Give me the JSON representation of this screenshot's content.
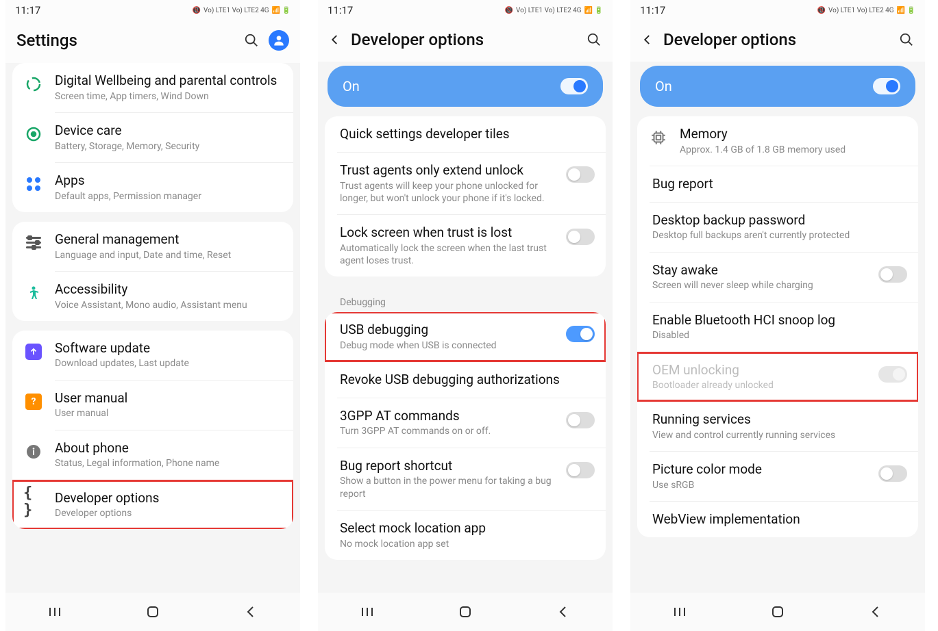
{
  "statusbar_time": "11:17",
  "statusbar_signal": "Vo) LTE1 Vo) LTE2 4G",
  "screen1": {
    "title": "Settings",
    "items": [
      {
        "title": "Digital Wellbeing and parental controls",
        "sub": "Screen time, App timers, Wind Down"
      },
      {
        "title": "Device care",
        "sub": "Battery, Storage, Memory, Security"
      },
      {
        "title": "Apps",
        "sub": "Default apps, Permission manager"
      },
      {
        "title": "General management",
        "sub": "Language and input, Date and time, Reset"
      },
      {
        "title": "Accessibility",
        "sub": "Voice Assistant, Mono audio, Assistant menu"
      },
      {
        "title": "Software update",
        "sub": "Download updates, Last update"
      },
      {
        "title": "User manual",
        "sub": "User manual"
      },
      {
        "title": "About phone",
        "sub": "Status, Legal information, Phone name"
      },
      {
        "title": "Developer options",
        "sub": "Developer options"
      }
    ]
  },
  "screen2": {
    "title": "Developer options",
    "pill": "On",
    "section0": [
      {
        "title": "Quick settings developer tiles"
      },
      {
        "title": "Trust agents only extend unlock",
        "sub": "Trust agents will keep your phone unlocked for longer, but won't unlock your phone if it's locked.",
        "toggle": "off"
      },
      {
        "title": "Lock screen when trust is lost",
        "sub": "Automatically lock the screen when the last trust agent loses trust.",
        "toggle": "off"
      }
    ],
    "section_label": "Debugging",
    "section1": [
      {
        "title": "USB debugging",
        "sub": "Debug mode when USB is connected",
        "toggle": "on"
      },
      {
        "title": "Revoke USB debugging authorizations"
      },
      {
        "title": "3GPP AT commands",
        "sub": "Turn 3GPP AT commands on or off.",
        "toggle": "off"
      },
      {
        "title": "Bug report shortcut",
        "sub": "Show a button in the power menu for taking a bug report",
        "toggle": "off"
      },
      {
        "title": "Select mock location app",
        "sub": "No mock location app set"
      }
    ]
  },
  "screen3": {
    "title": "Developer options",
    "pill": "On",
    "items": [
      {
        "title": "Memory",
        "sub": "Approx. 1.4 GB of 1.8 GB memory used"
      },
      {
        "title": "Bug report"
      },
      {
        "title": "Desktop backup password",
        "sub": "Desktop full backups aren't currently protected"
      },
      {
        "title": "Stay awake",
        "sub": "Screen will never sleep while charging",
        "toggle": "off"
      },
      {
        "title": "Enable Bluetooth HCI snoop log",
        "sub": "Disabled"
      },
      {
        "title": "OEM unlocking",
        "sub": "Bootloader already unlocked",
        "toggle": "disabled"
      },
      {
        "title": "Running services",
        "sub": "View and control currently running services"
      },
      {
        "title": "Picture color mode",
        "sub": "Use sRGB",
        "toggle": "off"
      },
      {
        "title": "WebView implementation"
      }
    ]
  }
}
